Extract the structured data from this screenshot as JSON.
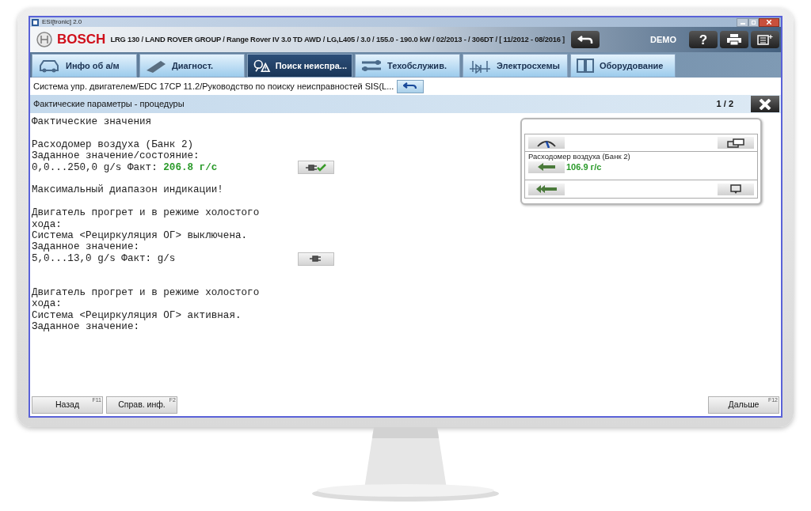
{
  "window": {
    "title": "ESI[tronic] 2.0"
  },
  "header": {
    "brand": "BOSCH",
    "vehicle": "LRG 130 / LAND ROVER GROUP / Range Rover IV 3.0 TD AWD / LG,L405 / 3.0 / 155.0 - 190.0 kW / 02/2013 - / 306DT / [ 11/2012 - 08/2016 ]",
    "mode": "DEMO",
    "help": "?"
  },
  "tabs": [
    {
      "label": "Инфо об а/м",
      "kind": "car",
      "selected": false
    },
    {
      "label": "Диагност.",
      "kind": "plug",
      "selected": false
    },
    {
      "label": "Поиск неиспра...",
      "kind": "search",
      "selected": true
    },
    {
      "label": "Техобслужив.",
      "kind": "wrench",
      "selected": false
    },
    {
      "label": "Электросхемы",
      "kind": "circuit",
      "selected": false
    },
    {
      "label": "Оборудование",
      "kind": "book",
      "selected": false
    }
  ],
  "breadcrumb": "Система упр. двигателем/EDC 17CP 11.2/Руководство по поиску неисправностей SIS(L...",
  "section": {
    "title": "Фактические параметры - процедуры",
    "page": "1 / 2"
  },
  "lines": [
    {
      "kind": "text",
      "text": "Фактические значения"
    },
    {
      "kind": "blank"
    },
    {
      "kind": "text",
      "text": "Расходомер воздуха (Банк 2)"
    },
    {
      "kind": "text",
      "text": "Заданное значение/состояние:"
    },
    {
      "kind": "reading",
      "text": "0,0...250,0 g/s Факт: ",
      "value": "206.8 г/с",
      "button": {
        "checked": true
      }
    },
    {
      "kind": "blank"
    },
    {
      "kind": "text",
      "text": "Максимальный диапазон индикации!"
    },
    {
      "kind": "blank"
    },
    {
      "kind": "text",
      "text": "Двигатель прогрет и в режиме холостого"
    },
    {
      "kind": "text",
      "text": "хода:"
    },
    {
      "kind": "text",
      "text": "Система <Рециркуляция ОГ> выключена."
    },
    {
      "kind": "text",
      "text": "Заданное значение:"
    },
    {
      "kind": "reading",
      "text": "5,0...13,0 g/s Факт: g/s",
      "button": {
        "checked": false
      }
    },
    {
      "kind": "blank"
    },
    {
      "kind": "blank"
    },
    {
      "kind": "text",
      "text": "Двигатель прогрет и в режиме холостого"
    },
    {
      "kind": "text",
      "text": "хода:"
    },
    {
      "kind": "text",
      "text": "Система <Рециркуляция ОГ> активная."
    },
    {
      "kind": "text",
      "text": "Заданное значение:"
    }
  ],
  "widget": {
    "label": "Расходомер воздуха (Банк 2)",
    "value": "106.9 г/с"
  },
  "footer": [
    {
      "label": "Назад",
      "key": "F11"
    },
    {
      "label": "Справ. инф.",
      "key": "F2"
    }
  ],
  "footer_right": {
    "label": "Дальше",
    "key": "F12"
  }
}
